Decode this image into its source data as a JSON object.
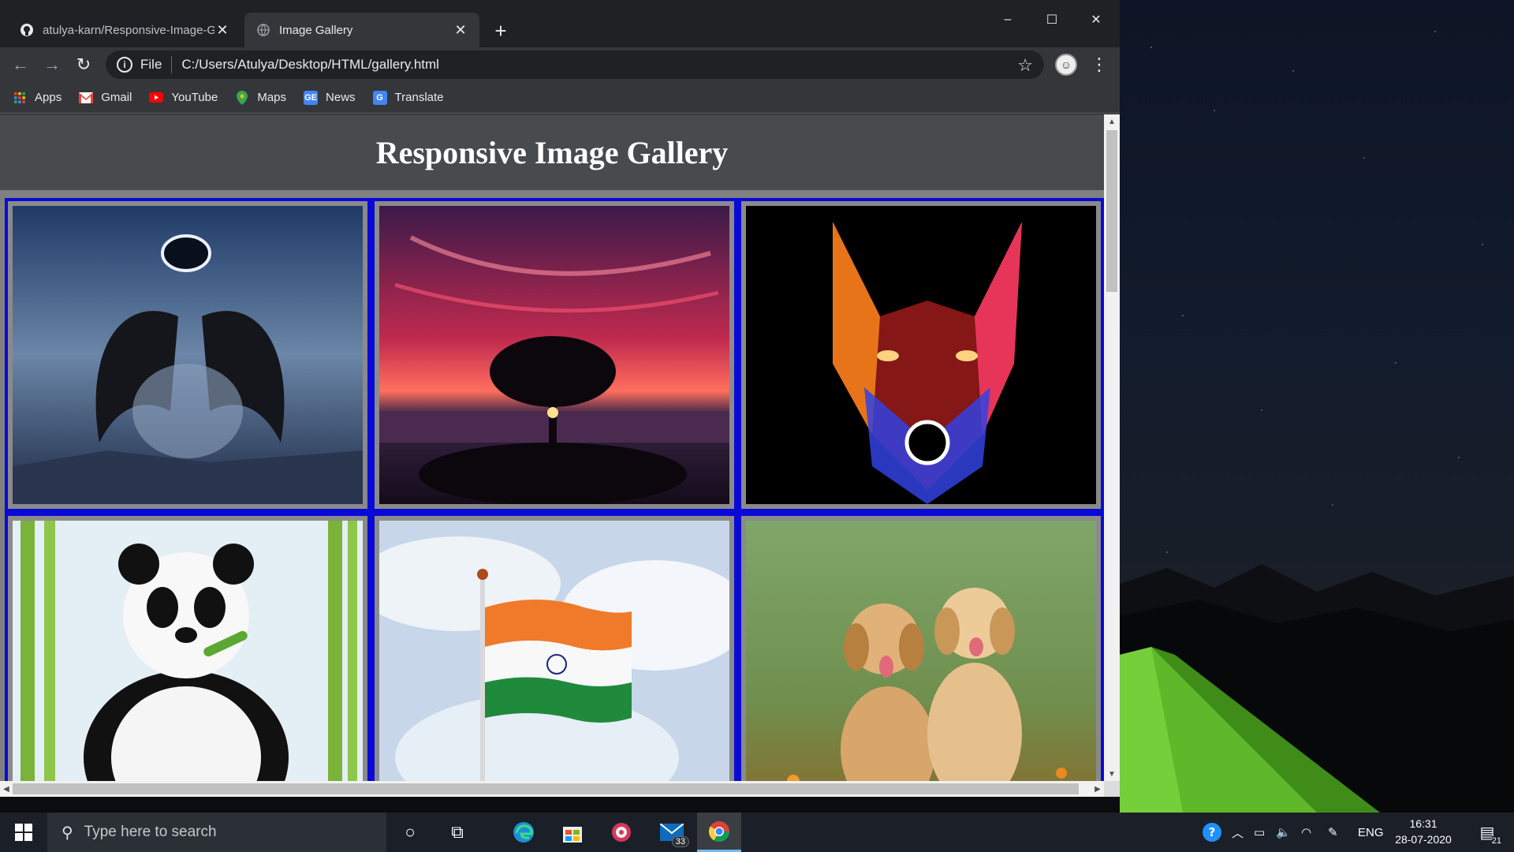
{
  "browser": {
    "tabs": [
      {
        "title": "atulya-karn/Responsive-Image-G",
        "favicon": "github-icon",
        "active": false
      },
      {
        "title": "Image Gallery",
        "favicon": "globe-icon",
        "active": true
      }
    ],
    "new_tab_symbol": "+",
    "window_controls": {
      "minimize": "–",
      "maximize": "☐",
      "close": "✕"
    },
    "address_bar": {
      "scheme": "File",
      "url": "C:/Users/Atulya/Desktop/HTML/gallery.html"
    },
    "bookmarks": [
      {
        "label": "Apps",
        "icon": "apps-grid-icon"
      },
      {
        "label": "Gmail",
        "icon": "gmail-icon"
      },
      {
        "label": "YouTube",
        "icon": "youtube-icon"
      },
      {
        "label": "Maps",
        "icon": "maps-icon"
      },
      {
        "label": "News",
        "icon": "news-icon"
      },
      {
        "label": "Translate",
        "icon": "translate-icon"
      }
    ]
  },
  "page": {
    "title": "Responsive Image Gallery",
    "gallery": [
      {
        "subject": "winged figure under eclipse",
        "icon": "angel-image"
      },
      {
        "subject": "tree at red sunset",
        "icon": "tree-sunset-image"
      },
      {
        "subject": "neon wolf",
        "icon": "wolf-image"
      },
      {
        "subject": "panda eating bamboo",
        "icon": "panda-image"
      },
      {
        "subject": "Indian flag",
        "icon": "flag-image"
      },
      {
        "subject": "two puppies in flowers",
        "icon": "puppies-image"
      }
    ],
    "colors": {
      "header_bg": "#484a4c",
      "gallery_bg": "#0a0ad6",
      "cell_border": "#8a8a8a"
    }
  },
  "taskbar": {
    "search_placeholder": "Type here to search",
    "pinned": [
      {
        "name": "cortana-icon"
      },
      {
        "name": "task-view-icon"
      },
      {
        "name": "edge-icon"
      },
      {
        "name": "store-icon"
      },
      {
        "name": "media-player-icon"
      },
      {
        "name": "mail-icon",
        "badge": "33"
      },
      {
        "name": "chrome-icon",
        "active": true
      }
    ],
    "tray": {
      "language": "ENG",
      "time": "16:31",
      "date": "28-07-2020",
      "notifications": "21"
    }
  }
}
